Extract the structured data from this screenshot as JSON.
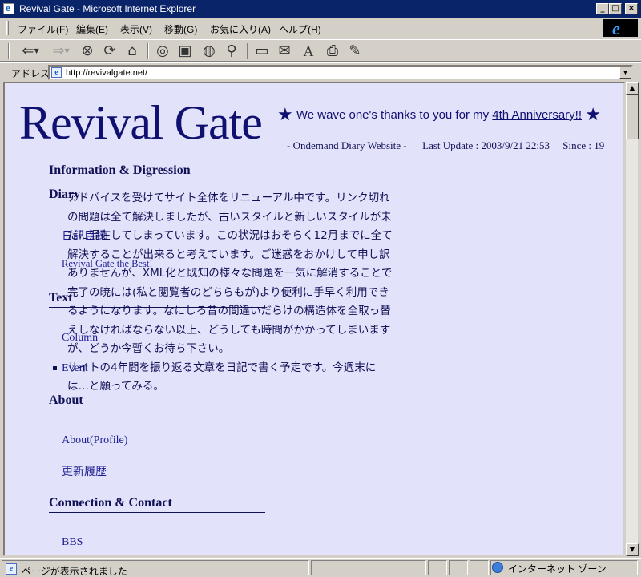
{
  "window": {
    "title": "Revival Gate - Microsoft Internet Explorer",
    "buttons": {
      "minimize": "_",
      "maximize": "□",
      "close": "×"
    }
  },
  "menu": {
    "items": [
      "ファイル(F)",
      "編集(E)",
      "表示(V)",
      "移動(G)",
      "お気に入り(A)",
      "ヘルプ(H)"
    ]
  },
  "toolbar": {
    "icons": [
      "back-icon",
      "forward-icon",
      "stop-icon",
      "refresh-icon",
      "home-icon",
      "search-icon",
      "favorites-icon",
      "history-icon",
      "channels-icon",
      "fullscreen-icon",
      "mail-icon",
      "font-icon",
      "print-icon",
      "edit-icon"
    ]
  },
  "address": {
    "label": "アドレス",
    "url": "http://revivalgate.net/"
  },
  "page": {
    "site_title": "Revival Gate",
    "anniversary_prefix": "We wave one's thanks to you for my ",
    "anniversary_link": "4th Anniversary!!",
    "star": "★",
    "subtitle": "- Ondemand Diary Website -",
    "last_update": "Last Update : 2003/9/21 22:53",
    "since": "Since : 19",
    "sections": {
      "info": "Information & Digression",
      "diary": "Diary",
      "text": "Text",
      "about": "About",
      "connection": "Connection & Contact"
    },
    "links": {
      "diary_list": "日記目録",
      "best": "Revival Gate the Best!",
      "column": "Column",
      "event": "Event",
      "profile": "About(Profile)",
      "history": "更新履歴",
      "bbs": "BBS"
    },
    "news": [
      "アドバイスを受けてサイト全体をリニューアル中です。リンク切れの問題は全て解決しましたが、古いスタイルと新しいスタイルが未だに混在してしまっています。この状況はおそらく12月までに全て解決することが出来ると考えています。ご迷惑をおかけして申し訳ありませんが、XML化と既知の様々な問題を一気に解消することで完了の暁には(私と閲覧者のどちらもが)より便利に手早く利用できるようになります。なにしろ昔の間違いだらけの構造体を全取っ替えしなければならない以上、どうしても時間がかかってしまいますが、どうか今暫くお待ち下さい。",
      "サイトの4年間を振り返る文章を日記で書く予定です。今週末には…と願ってみる。"
    ]
  },
  "status": {
    "text": "ページが表示されました",
    "zone": "インターネット ゾーン"
  }
}
